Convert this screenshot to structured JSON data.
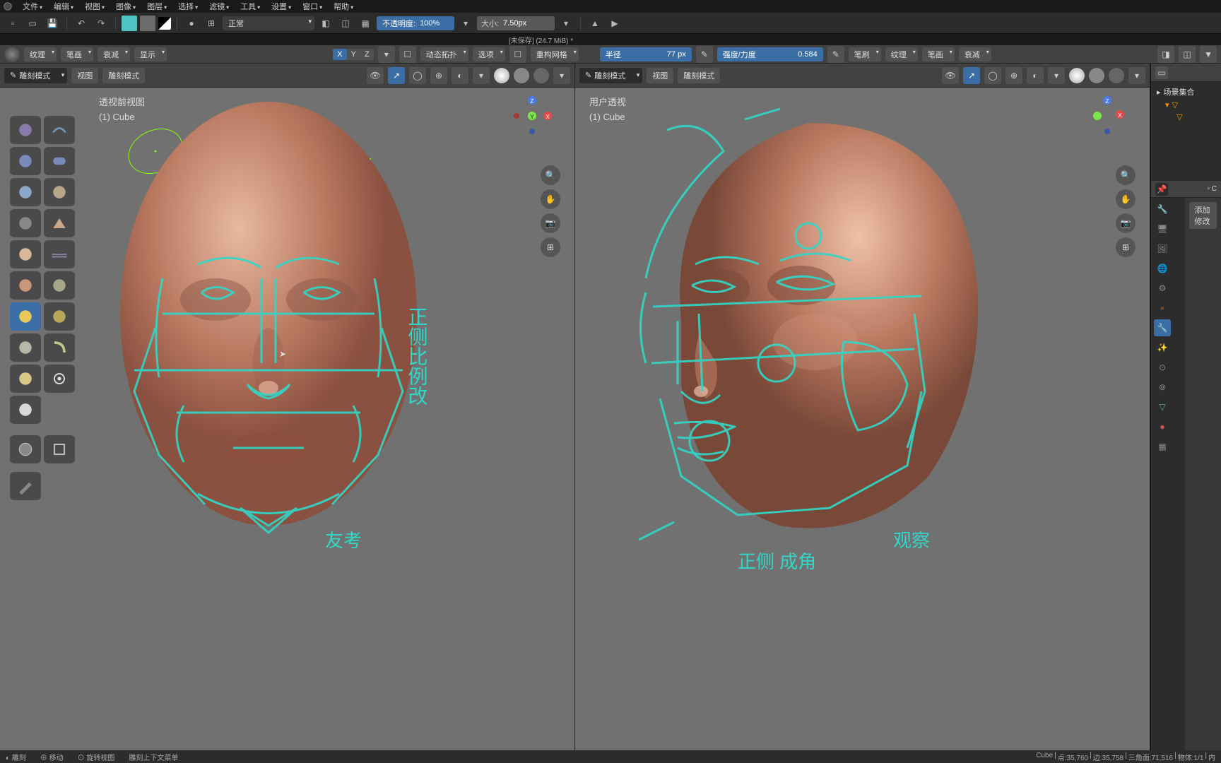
{
  "menu": {
    "items": [
      "文件",
      "编辑",
      "视图",
      "图像",
      "图层",
      "选择",
      "滤镜",
      "工具",
      "设置",
      "窗口",
      "帮助"
    ]
  },
  "toolbar": {
    "mode": "正常",
    "opacity_label": "不透明度:",
    "opacity_value": "100%",
    "size_label": "大小:",
    "size_value": "7.50px"
  },
  "file_title": "[未保存] (24.7 MiB) *",
  "toolbar2": {
    "texture": "纹理",
    "stroke": "笔画",
    "falloff": "衰减",
    "display": "显示",
    "axis_x": "X",
    "axis_y": "Y",
    "axis_z": "Z",
    "dyntopo": "动态拓扑",
    "options": "选项",
    "remesh": "重构网格",
    "radius_label": "半径",
    "radius_value": "77 px",
    "strength_label": "强度/力度",
    "strength_value": "0.584",
    "brush": "笔刷",
    "texture2": "纹理",
    "stroke2": "笔画",
    "falloff2": "衰减"
  },
  "viewport": {
    "mode": "雕刻模式",
    "view_btn": "视图",
    "sculpt_btn": "雕刻模式",
    "left": {
      "title": "透视前视图",
      "object": "(1) Cube"
    },
    "right": {
      "title": "用户透视",
      "object": "(1) Cube"
    }
  },
  "outliner": {
    "title": "场景集合",
    "obj_c": "C"
  },
  "props": {
    "add_modifier": "添加修改"
  },
  "status": {
    "sculpt": "雕刻",
    "move": "移动",
    "rotate": "旋转视图",
    "context": "雕刻上下文菜单",
    "obj": "Cube",
    "verts": "点:35,760",
    "edges": "边:35,758",
    "tris": "三角面:71,516",
    "objects": "物体:1/1",
    "mem": "内"
  }
}
